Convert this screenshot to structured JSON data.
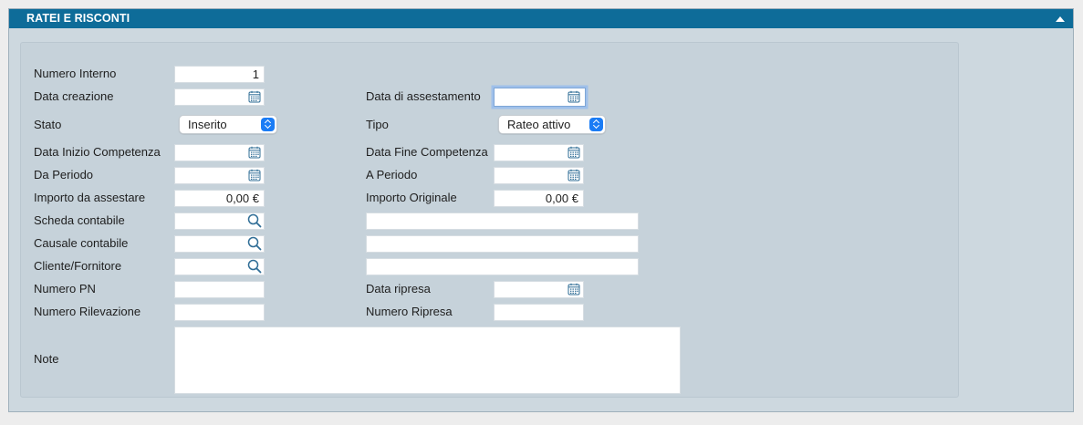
{
  "window": {
    "title": "RATEI E RISCONTI"
  },
  "colors": {
    "titlebar": "#0e6c99",
    "panel": "#c6d2da",
    "accent": "#1a7cf5",
    "icon": "#2f6d96"
  },
  "icons": {
    "calendar": "calendar-icon",
    "search": "search-icon",
    "collapse": "chevron-up-icon"
  },
  "form": {
    "numero_interno": {
      "label": "Numero Interno",
      "value": "1"
    },
    "data_creazione": {
      "label": "Data creazione",
      "value": ""
    },
    "data_assestamento": {
      "label": "Data di assestamento",
      "value": ""
    },
    "stato": {
      "label": "Stato",
      "value": "Inserito"
    },
    "tipo": {
      "label": "Tipo",
      "value": "Rateo attivo"
    },
    "data_inizio_competenza": {
      "label": "Data Inizio Competenza",
      "value": ""
    },
    "data_fine_competenza": {
      "label": "Data Fine Competenza",
      "value": ""
    },
    "da_periodo": {
      "label": "Da Periodo",
      "value": ""
    },
    "a_periodo": {
      "label": "A Periodo",
      "value": ""
    },
    "importo_da_assestare": {
      "label": "Importo da assestare",
      "value": "0,00 €"
    },
    "importo_originale": {
      "label": "Importo Originale",
      "value": "0,00 €"
    },
    "scheda_contabile": {
      "label": "Scheda contabile",
      "value": "",
      "description": ""
    },
    "causale_contabile": {
      "label": "Causale contabile",
      "value": "",
      "description": ""
    },
    "cliente_fornitore": {
      "label": "Cliente/Fornitore",
      "value": "",
      "description": ""
    },
    "numero_pn": {
      "label": "Numero PN",
      "value": ""
    },
    "data_ripresa": {
      "label": "Data ripresa",
      "value": ""
    },
    "numero_rilevazione": {
      "label": "Numero Rilevazione",
      "value": ""
    },
    "numero_ripresa": {
      "label": "Numero Ripresa",
      "value": ""
    },
    "note": {
      "label": "Note",
      "value": ""
    }
  }
}
